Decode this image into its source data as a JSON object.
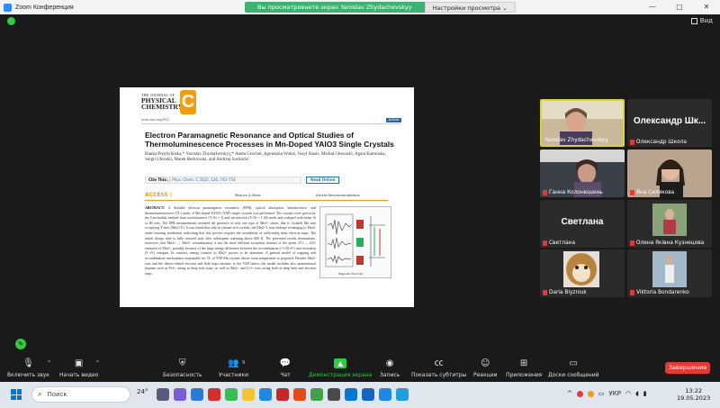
{
  "window": {
    "title": "Zoom Конференция",
    "controls": [
      "—",
      "▢",
      "✕"
    ]
  },
  "banner": {
    "text": "Вы просматриваете экран Yaroslav Zhydachevskyy",
    "view_options": "Настройки просмотра ⌄"
  },
  "view_button": "Вид",
  "document": {
    "journal_line1": "THE JOURNAL OF",
    "journal_line2": "PHYSICAL",
    "journal_line3": "CHEMISTRY",
    "journal_letter": "C",
    "url": "pubs.acs.org/JPCC",
    "badge": "Article",
    "title": "Electron Paramagnetic Resonance and Optical Studies of Thermoluminescence Processes in Mn-Doped YAlO3 Single Crystals",
    "authors": "Hanka Przybylińska,* Yaroslav Zhydachevskyy,* Aneta Grochot, Agnieszka Wołoś, Vasyl Stasiv, Michał Głowacki, Agata Kamińska, Sergii Ubizskii, Marek Berkowski, and Andrzej Suchocki",
    "cite_label": "Cite This:",
    "cite_ref": "J. Phys. Chem. C 2022, 126, 743–753",
    "read_online": "Read Online",
    "access": "ACCESS |",
    "metrics": "Metrics & More",
    "recommendations": "Article Recommendations",
    "abstract_label": "ABSTRACT:",
    "abstract": "A detailed electron paramagnetic resonance (EPR), optical absorption, luminescence, and thermoluminescence (TL) study of Mn-doped YAlO3 (YAP) single crystals was performed. The crystals were grown by the Czochralski method from stoichiometric (Y/Al = 1) and yttrium-rich (Y/Al = 1.04) melts and codoped with either Si or Hf ions. The EPR measurements revealed the presence of only one type of Mn2+ center, that is, isolated Mn ions occupying Y sites (Mn2+Y). It was found that only in yttrium-rich crystals, the Mn2+Y ions undergo recharging to Mn4+ under ionizing irradiation, indicating that this process requires the availability of sufficiently deep electron traps. The initial charge state is fully restored only after subsequent warming above 600 K. The presented results demonstrate, moreover, that Mn2+ → Mn3+ recombination is not the most efficient excitation channel of the green 4T1 → 6A1 emission of Mn2+, possibly because of the large energy difference between the recombination (~5.39 eV) and excitation (3 eV) energies. In contrast, energy transfer to Mn2+ proves to be dominant. A general model of trapping and recombination mechanisms responsible for TL of YAP:Mn crystals above room temperature is proposed. Besides Mn2+ ions and the defect-related electron and hole traps intrinsic to the YAP lattice, the model includes also unintentional dopants such as Fe3+ acting as deep hole traps, as well as Mn2+ and Cr3+ ions acting both as deep hole and electron traps.",
    "graphic_axis": "Magnetic Field (G)"
  },
  "participants": [
    {
      "name": "Yaroslav Zhydachevskyy",
      "display": "",
      "muted": false,
      "active": true
    },
    {
      "name": "Олександр Школа",
      "display": "Олександр Шк...",
      "muted": true,
      "active": false
    },
    {
      "name": "Ганна Колонюшень",
      "display": "",
      "muted": true,
      "active": false
    },
    {
      "name": "Яна Силякова",
      "display": "",
      "muted": true,
      "active": false
    },
    {
      "name": "Светлана",
      "display": "Светлана",
      "muted": true,
      "active": false
    },
    {
      "name": "Олена Яківна Кузнецова",
      "display": "",
      "muted": true,
      "active": false
    },
    {
      "name": "Daria Blyzniuk",
      "display": "",
      "muted": true,
      "active": false
    },
    {
      "name": "Viktoria Bondarenko",
      "display": "",
      "muted": true,
      "active": false
    }
  ],
  "toolbar": {
    "mic": "Включить звук",
    "video": "Начать видео",
    "security": "Безопасность",
    "participants": "Участники",
    "participants_count": "9",
    "chat": "Чат",
    "share": "Демонстрация экрана",
    "record": "Запись",
    "captions": "Показать субтитры",
    "reactions": "Реакции",
    "apps": "Приложения",
    "whiteboard": "Доски сообщений",
    "end": "Завершение"
  },
  "taskbar": {
    "search_placeholder": "Поиск",
    "weather": "24°",
    "lang": "УКР",
    "time": "13:22",
    "date": "19.05.2023"
  },
  "colors": {
    "accent_green": "#2ecc40",
    "end_red": "#e53935",
    "journal_orange": "#f39c12",
    "link_blue": "#1f6fb5"
  }
}
